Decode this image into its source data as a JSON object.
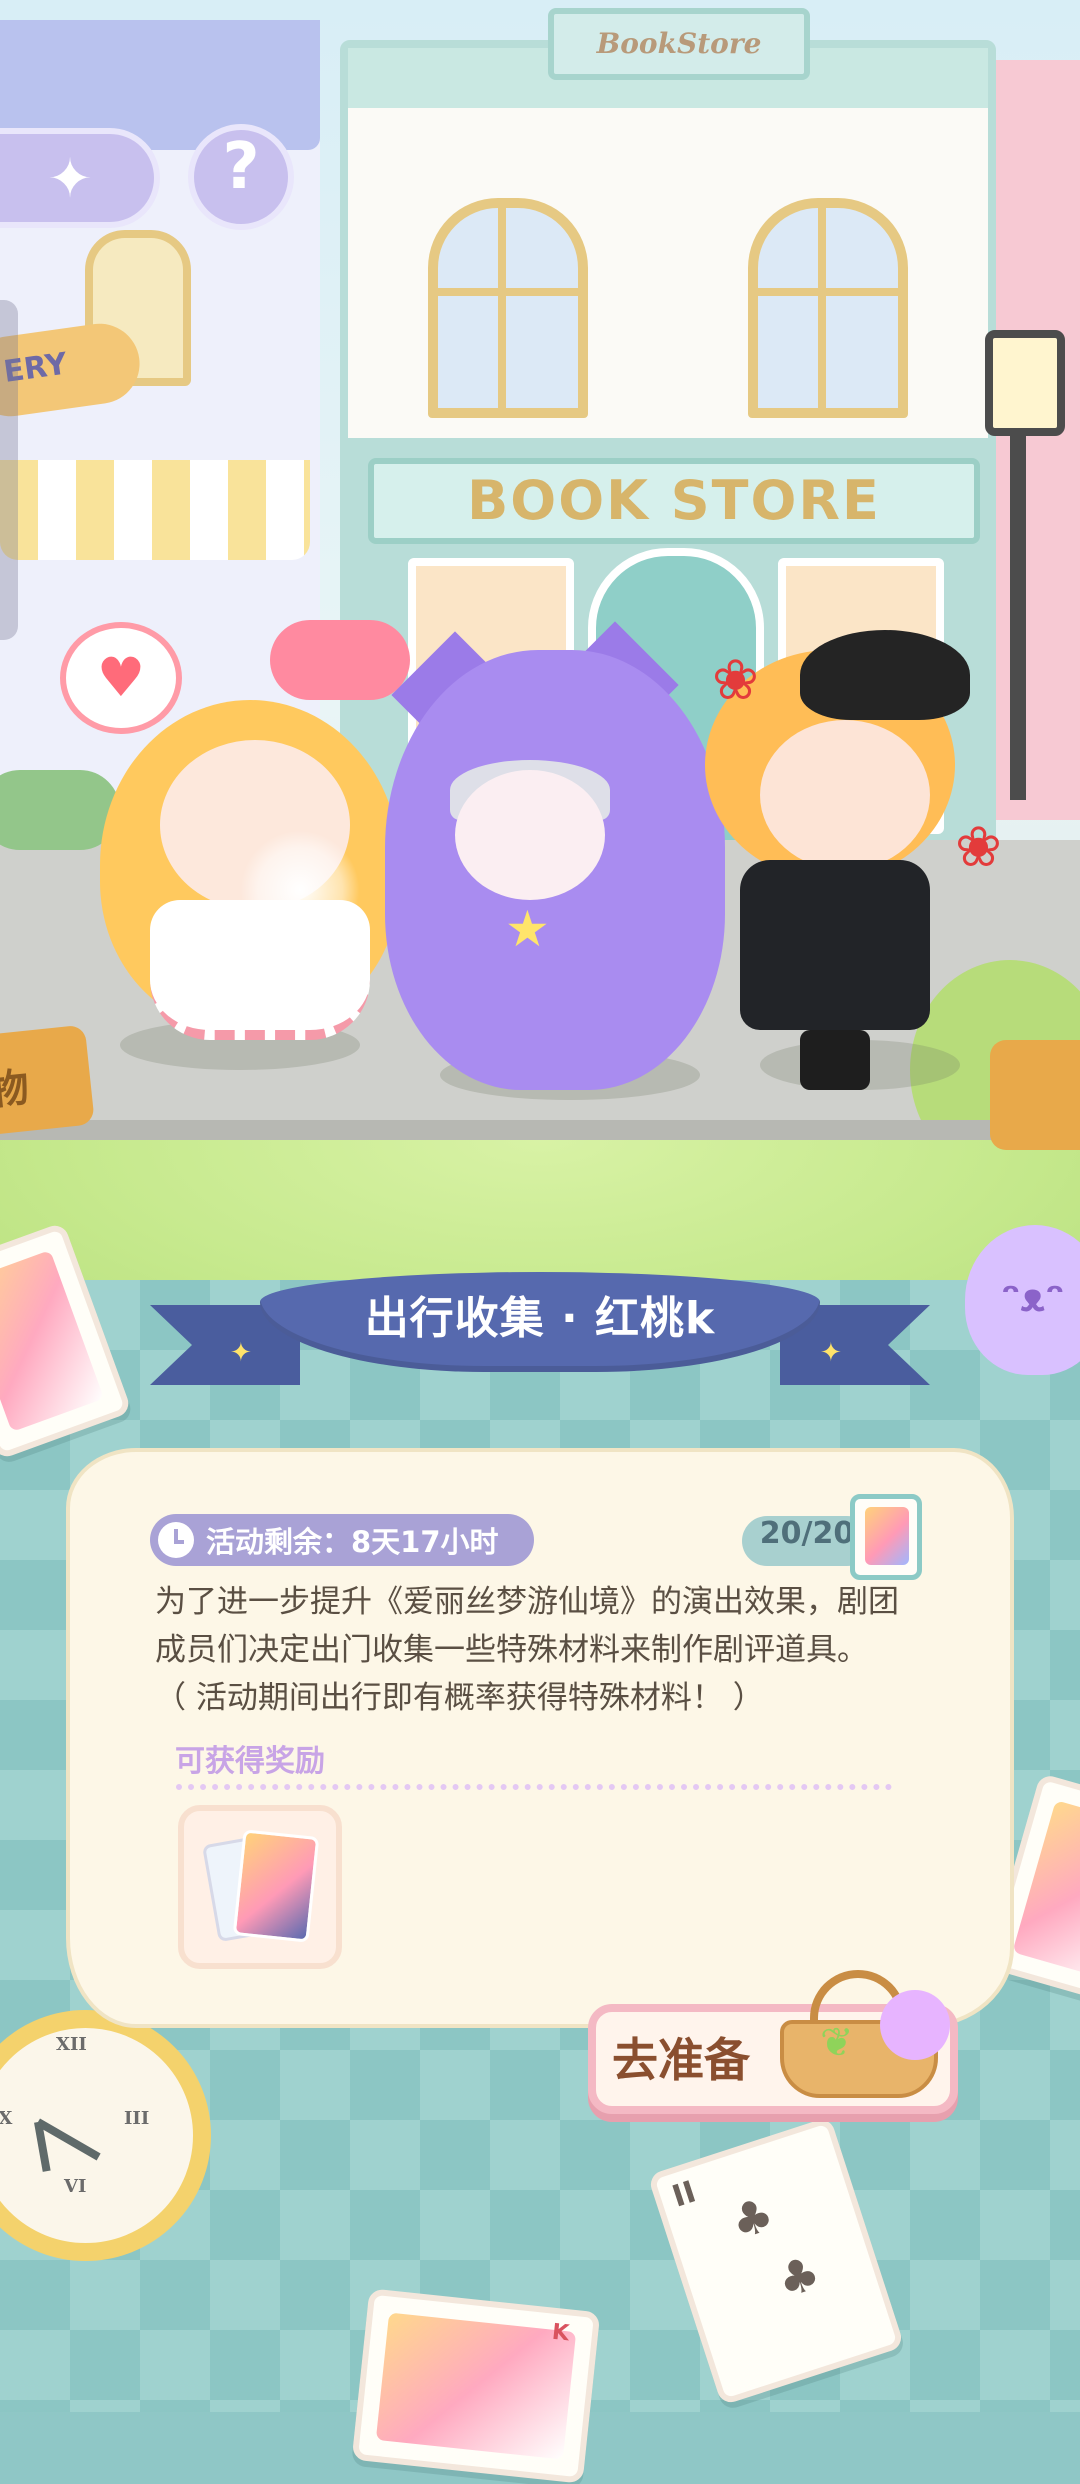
{
  "scene": {
    "bookstore_top_sign": "BookStore",
    "bookstore_sign": "BOOK STORE",
    "bakery_sign_fragment": "ERY",
    "left_sign_fragment": "物"
  },
  "hud": {
    "menu_icon": "sparkle-emblem-icon",
    "help_label": "?"
  },
  "event": {
    "title": "出行收集 · 红桃k",
    "timer_label": "活动剩余：8天17小时",
    "progress_text": "20/20",
    "progress": {
      "current": 20,
      "total": 20
    },
    "description_lines": [
      "为了进一步提升《爱丽丝梦游仙境》的演出效果，剧团",
      "成员们决定出门收集一些特殊材料来制作剧评道具。",
      "（ 活动期间出行即有概率获得特殊材料！ ）"
    ],
    "rewards_title": "可获得奖励",
    "reward_item_icon": "heart-king-card-icon",
    "go_button_label": "去准备"
  },
  "decor": {
    "club_card_rank": "II",
    "card_suit_club": "♣",
    "card_suit_heart": "♥",
    "card_bottom_rank": "K",
    "clock_numerals": [
      "XII",
      "III",
      "VI",
      "IX"
    ]
  },
  "colors": {
    "ribbon": "#5669ae",
    "panel": "#fdf7e7",
    "timer_pill": "#a9a2d6",
    "button_border": "#f4b9c4",
    "accent_text": "#8a4f2f"
  }
}
